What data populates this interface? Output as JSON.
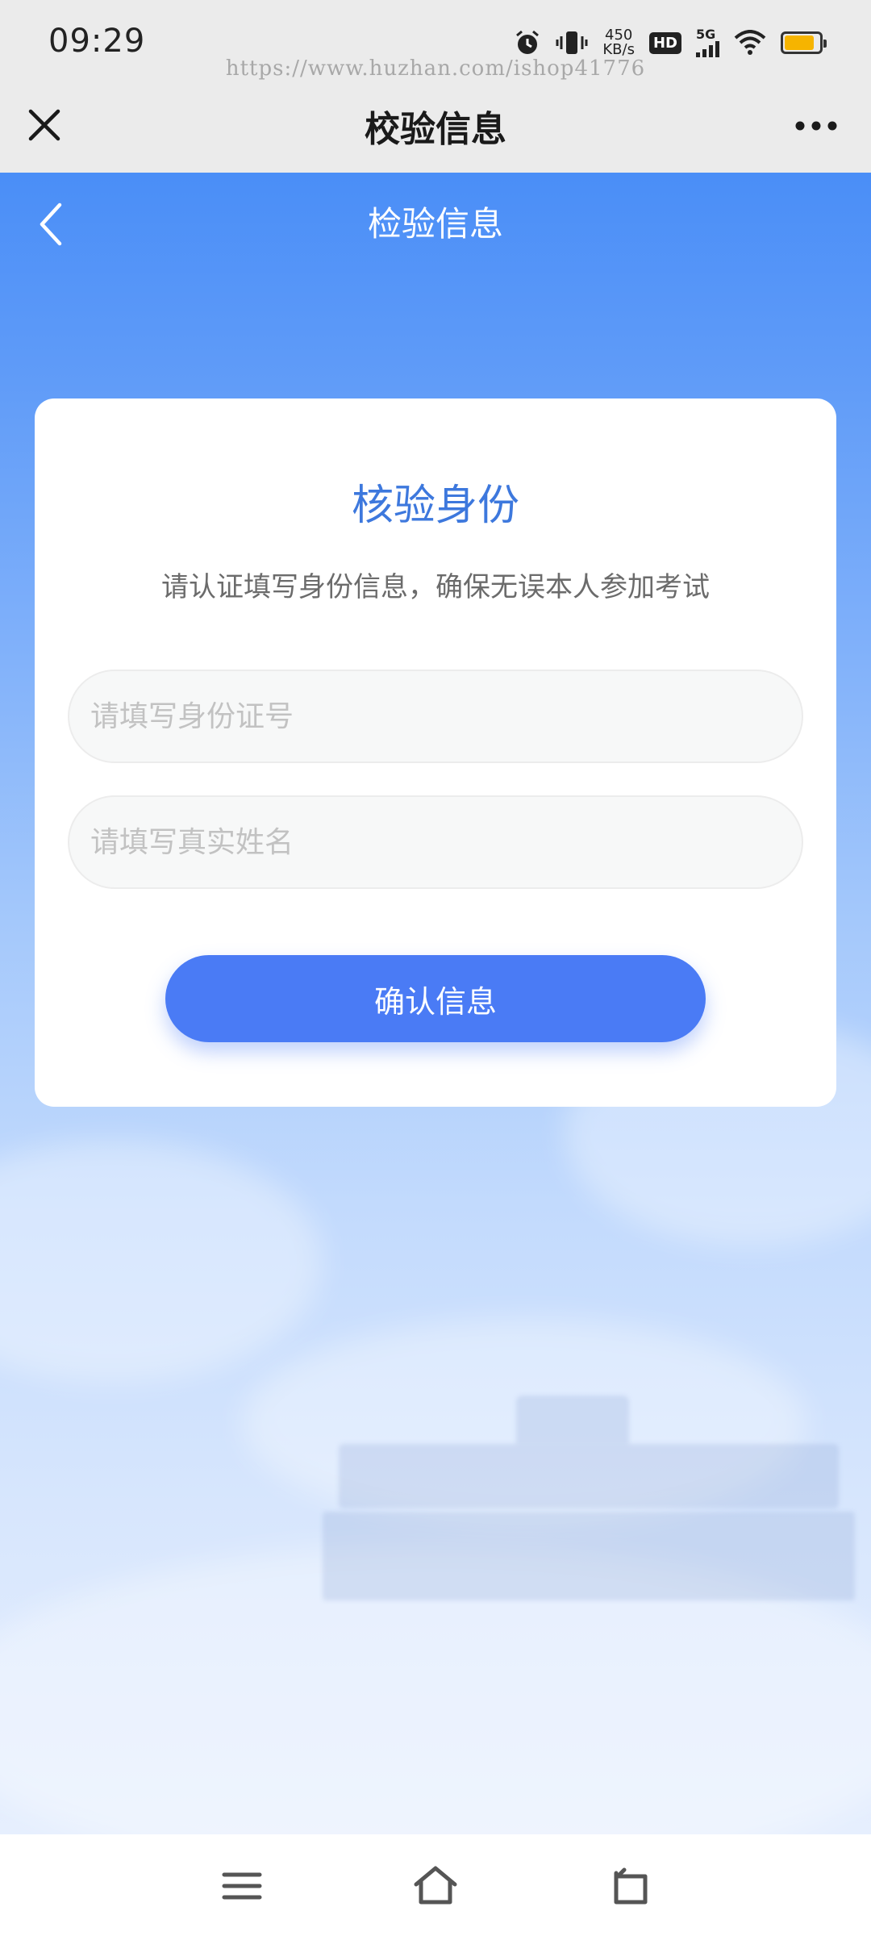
{
  "status_bar": {
    "time": "09:29",
    "net_speed_value": "450",
    "net_speed_unit": "KB/s",
    "hd_label": "HD",
    "signal_label": "5G",
    "battery_level": 0.85,
    "battery_color": "#f6b400",
    "icons": [
      "alarm-icon",
      "vibrate-icon",
      "wifi-icon",
      "battery-icon"
    ]
  },
  "watermark": "https://www.huzhan.com/ishop41776",
  "mp_header": {
    "title": "校验信息",
    "close_icon": "close-icon",
    "more_icon": "more-icon"
  },
  "nav": {
    "title": "检验信息",
    "back_icon": "chevron-left-icon"
  },
  "card": {
    "title": "核验身份",
    "subtitle": "请认证填写身份信息，确保无误本人参加考试",
    "id_field": {
      "placeholder": "请填写身份证号",
      "value": ""
    },
    "name_field": {
      "placeholder": "请填写真实姓名",
      "value": ""
    },
    "confirm_label": "确认信息"
  },
  "colors": {
    "accent": "#4a7bf5",
    "title_blue": "#3d78dd",
    "header_gray": "#ebebeb"
  },
  "system_nav": {
    "icons": [
      "menu-icon",
      "home-icon",
      "back-icon"
    ]
  }
}
